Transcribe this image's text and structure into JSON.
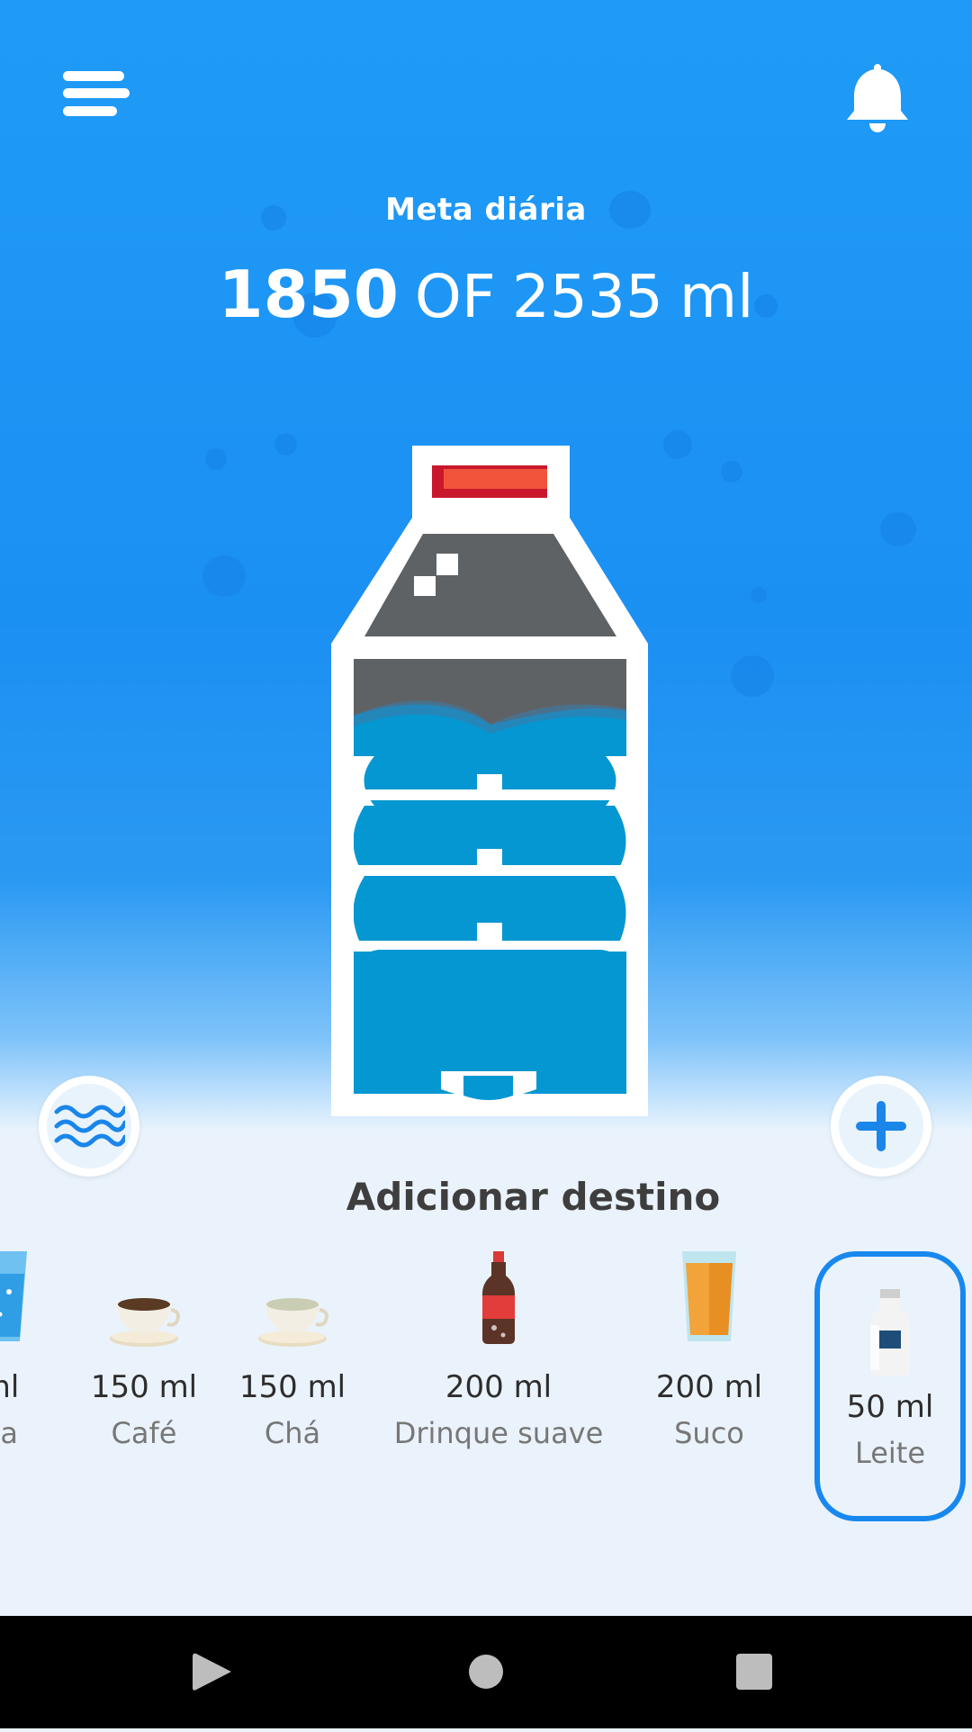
{
  "header": {
    "goal_label": "Meta diária",
    "consumed": "1850",
    "of_label": "OF",
    "target": "2535",
    "unit": "ml"
  },
  "colors": {
    "accent": "#1888ee",
    "water": "#0597d1",
    "bottle_cap": "#e8382f"
  },
  "progress": {
    "fraction": 0.73
  },
  "icons": {
    "menu": "menu-icon",
    "bell": "bell-icon",
    "waves": "waves-icon",
    "plus": "plus-icon"
  },
  "panel": {
    "title": "Adicionar destino",
    "drinks": [
      {
        "amount": "ml",
        "name": "ua",
        "icon": "water-glass-icon"
      },
      {
        "amount": "150 ml",
        "name": "Café",
        "icon": "coffee-cup-icon"
      },
      {
        "amount": "150 ml",
        "name": "Chá",
        "icon": "tea-cup-icon"
      },
      {
        "amount": "200 ml",
        "name": "Drinque suave",
        "icon": "soda-bottle-icon"
      },
      {
        "amount": "200 ml",
        "name": "Suco",
        "icon": "juice-glass-icon"
      },
      {
        "amount": "50 ml",
        "name": "Leite",
        "icon": "milk-bottle-icon",
        "selected": true
      }
    ]
  }
}
